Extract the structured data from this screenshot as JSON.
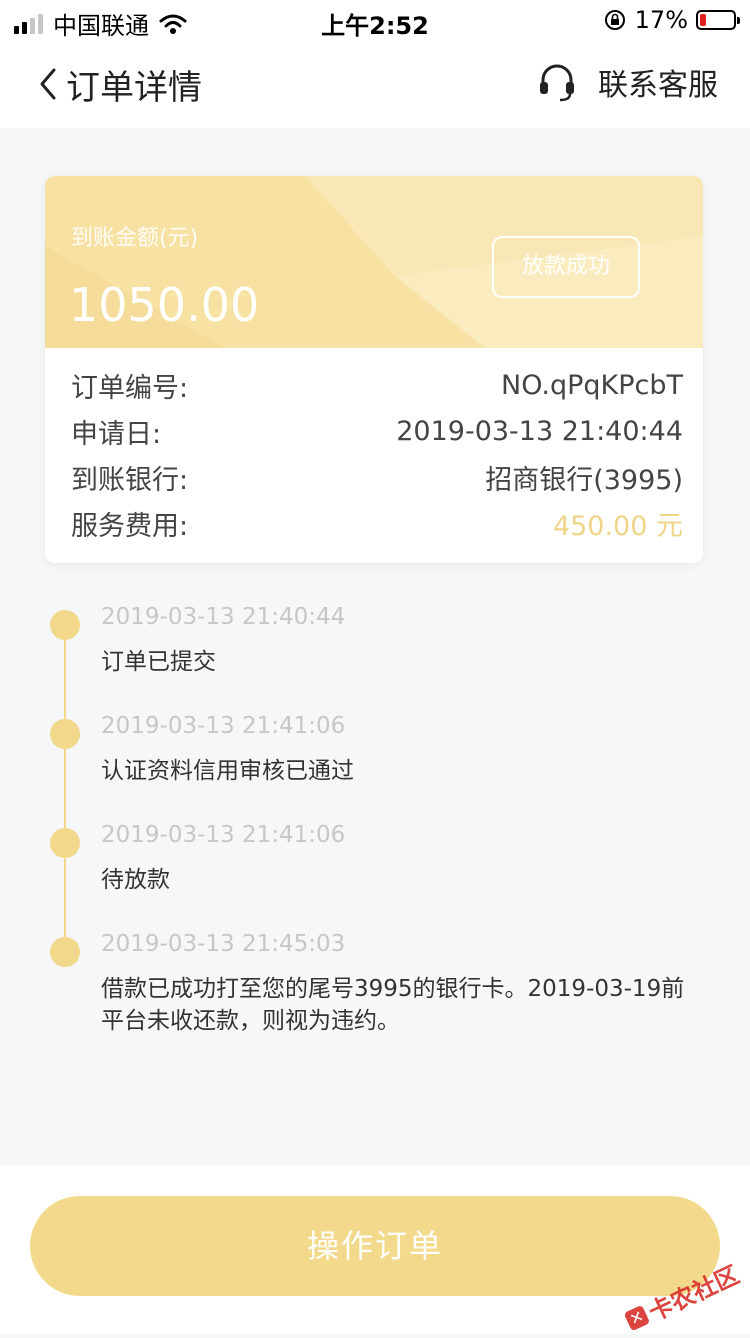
{
  "status_bar": {
    "carrier": "中国联通",
    "time": "上午2:52",
    "battery_percent": "17%",
    "battery_level": 0.17,
    "battery_color": "#e02020"
  },
  "nav": {
    "title": "订单详情",
    "service_label": "联系客服"
  },
  "card": {
    "amount_label": "到账金额(元)",
    "amount": "1050.00",
    "status": "放款成功",
    "rows": [
      {
        "label": "订单编号:",
        "value": "NO.qPqKPcbT"
      },
      {
        "label": "申请日:",
        "value": "2019-03-13 21:40:44"
      },
      {
        "label": "到账银行:",
        "value": "招商银行(3995)"
      },
      {
        "label": "服务费用:",
        "value": "450.00 元"
      }
    ]
  },
  "timeline": [
    {
      "time": "2019-03-13 21:40:44",
      "text": "订单已提交"
    },
    {
      "time": "2019-03-13 21:41:06",
      "text": "认证资料信用审核已通过"
    },
    {
      "time": "2019-03-13 21:41:06",
      "text": "待放款"
    },
    {
      "time": "2019-03-13 21:45:03",
      "text": "借款已成功打至您的尾号3995的银行卡。2019-03-19前平台未收还款，则视为违约。"
    }
  ],
  "action_button": "操作订单",
  "watermark": "卡农社区",
  "colors": {
    "accent": "#f2d98b",
    "card_header": "#f7e2a4",
    "fee": "#f0d48a",
    "timeline": "#f2d88a"
  },
  "icons": [
    "back-chevron-icon",
    "headset-icon",
    "signal-icon",
    "wifi-icon",
    "rotation-lock-icon",
    "battery-icon"
  ]
}
